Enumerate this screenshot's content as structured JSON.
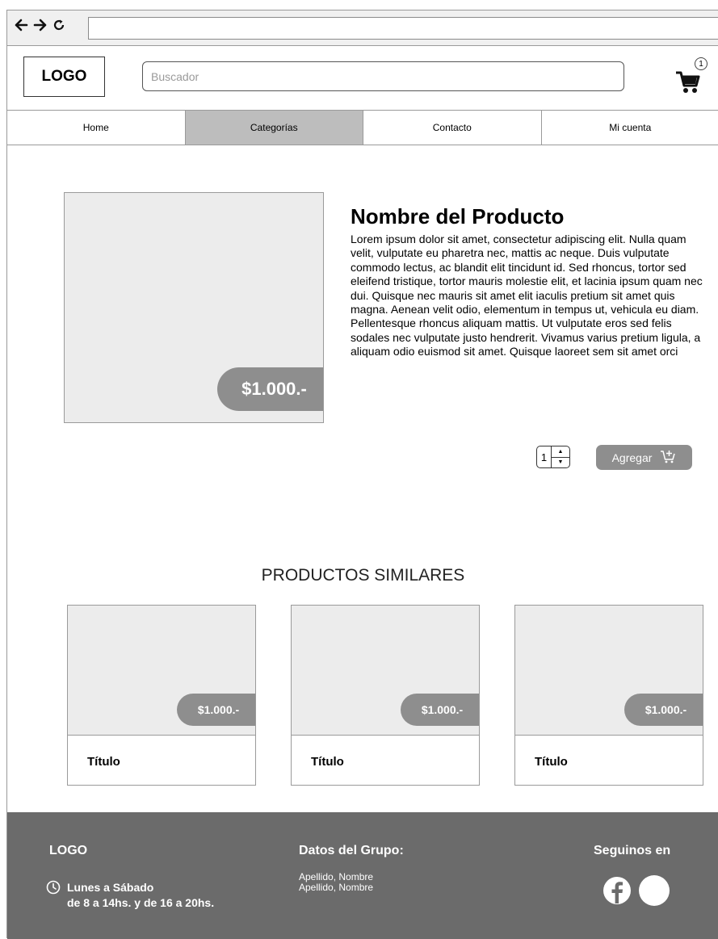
{
  "browser": {
    "url": ""
  },
  "header": {
    "logo": "LOGO",
    "search_placeholder": "Buscador",
    "cart_count": "1"
  },
  "nav": {
    "items": [
      {
        "label": "Home"
      },
      {
        "label": "Categorías"
      },
      {
        "label": "Contacto"
      },
      {
        "label": "Mi cuenta"
      }
    ]
  },
  "product": {
    "name": "Nombre del Producto",
    "price": "$1.000.-",
    "description": "Lorem ipsum dolor sit amet, consectetur adipiscing elit. Nulla quam velit, vulputate eu pharetra nec, mattis ac neque. Duis vulputate commodo lectus, ac blandit elit tincidunt id. Sed rhoncus, tortor sed eleifend tristique, tortor mauris molestie elit, et lacinia ipsum quam nec dui. Quisque nec mauris sit amet elit iaculis pretium sit amet quis magna. Aenean velit odio, elementum in tempus ut, vehicula eu diam. Pellentesque rhoncus aliquam mattis. Ut vulputate eros sed felis sodales nec vulputate justo hendrerit. Vivamus varius pretium ligula, a aliquam odio euismod sit amet. Quisque laoreet sem sit amet orci",
    "quantity": "1",
    "add_label": "Agregar"
  },
  "similar": {
    "title": "PRODUCTOS SIMILARES",
    "items": [
      {
        "title": "Título",
        "price": "$1.000.-"
      },
      {
        "title": "Título",
        "price": "$1.000.-"
      },
      {
        "title": "Título",
        "price": "$1.000.-"
      }
    ]
  },
  "footer": {
    "logo": "LOGO",
    "hours_line1": "Lunes a Sábado",
    "hours_line2": "de 8 a 14hs. y de 16 a 20hs.",
    "group_title": "Datos del Grupo:",
    "members": [
      "Apellido, Nombre",
      "Apellido, Nombre"
    ],
    "follow": "Seguinos en"
  }
}
